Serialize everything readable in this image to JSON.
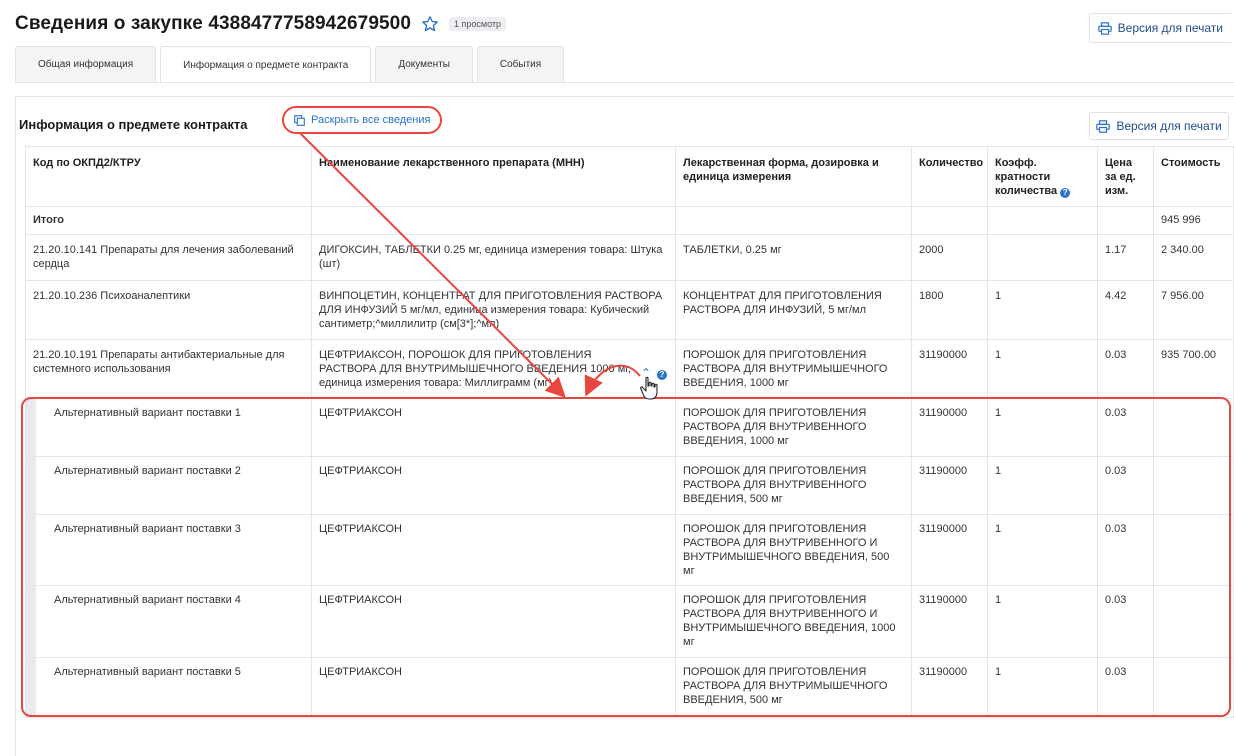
{
  "header": {
    "title": "Сведения о закупке 4388477758942679500",
    "views": "1 просмотр",
    "print_label": "Версия для печати"
  },
  "tabs": [
    {
      "label": "Общая информация",
      "active": false
    },
    {
      "label": "Информация о предмете контракта",
      "active": true
    },
    {
      "label": "Документы",
      "active": false
    },
    {
      "label": "События",
      "active": false
    }
  ],
  "section": {
    "title": "Информация о предмете контракта",
    "expand_label": "Раскрыть все сведения",
    "print_label": "Версия для печати"
  },
  "table": {
    "headers": {
      "code": "Код по ОКПД2/КТРУ",
      "name": "Наименование лекарственного препарата (МНН)",
      "form": "Лекарственная форма, дозировка и единица измерения",
      "qty": "Количество",
      "coef": "Коэфф. кратности количества",
      "price": "Цена за ед. изм.",
      "cost": "Стоимость"
    },
    "total": {
      "label": "Итого",
      "cost": "945 996"
    },
    "rows": [
      {
        "code": "21.20.10.141 Препараты для лечения заболеваний сердца",
        "name": "ДИГОКСИН, ТАБЛЕТКИ 0.25 мг, единица измерения товара: Штука (шт)",
        "form": "ТАБЛЕТКИ, 0.25 мг",
        "qty": "2000",
        "coef": "",
        "price": "1.17",
        "cost": "2 340.00"
      },
      {
        "code": "21.20.10.236 Психоаналептики",
        "name": "ВИНПОЦЕТИН, КОНЦЕНТРАТ ДЛЯ ПРИГОТОВЛЕНИЯ РАСТВОРА ДЛЯ ИНФУЗИЙ 5 мг/мл, единица измерения товара: Кубический сантиметр;^миллилитр (см[3*];^мл)",
        "form": "КОНЦЕНТРАТ ДЛЯ ПРИГОТОВЛЕНИЯ РАСТВОРА ДЛЯ ИНФУЗИЙ, 5 мг/мл",
        "qty": "1800",
        "coef": "1",
        "price": "4.42",
        "cost": "7 956.00"
      },
      {
        "code": "21.20.10.191 Препараты антибактериальные для системного использования",
        "name": "ЦЕФТРИАКСОН, ПОРОШОК ДЛЯ ПРИГОТОВЛЕНИЯ РАСТВОРА ДЛЯ ВНУТРИМЫШЕЧНОГО ВВЕДЕНИЯ 1000 мг, единица измерения товара: Миллиграмм (мг)",
        "form": "ПОРОШОК ДЛЯ ПРИГОТОВЛЕНИЯ РАСТВОРА ДЛЯ ВНУТРИМЫШЕЧНОГО ВВЕДЕНИЯ, 1000 мг",
        "qty": "31190000",
        "coef": "1",
        "price": "0.03",
        "cost": "935 700.00"
      }
    ],
    "alternatives": [
      {
        "label": "Альтернативный вариант поставки 1",
        "name": "ЦЕФТРИАКСОН",
        "form": "ПОРОШОК ДЛЯ ПРИГОТОВЛЕНИЯ РАСТВОРА ДЛЯ ВНУТРИВЕННОГО ВВЕДЕНИЯ, 1000 мг",
        "qty": "31190000",
        "coef": "1",
        "price": "0.03"
      },
      {
        "label": "Альтернативный вариант поставки 2",
        "name": "ЦЕФТРИАКСОН",
        "form": "ПОРОШОК ДЛЯ ПРИГОТОВЛЕНИЯ РАСТВОРА ДЛЯ ВНУТРИВЕННОГО ВВЕДЕНИЯ, 500 мг",
        "qty": "31190000",
        "coef": "1",
        "price": "0.03"
      },
      {
        "label": "Альтернативный вариант поставки 3",
        "name": "ЦЕФТРИАКСОН",
        "form": "ПОРОШОК ДЛЯ ПРИГОТОВЛЕНИЯ РАСТВОРА ДЛЯ ВНУТРИВЕННОГО И ВНУТРИМЫШЕЧНОГО ВВЕДЕНИЯ, 500 мг",
        "qty": "31190000",
        "coef": "1",
        "price": "0.03"
      },
      {
        "label": "Альтернативный вариант поставки 4",
        "name": "ЦЕФТРИАКСОН",
        "form": "ПОРОШОК ДЛЯ ПРИГОТОВЛЕНИЯ РАСТВОРА ДЛЯ ВНУТРИВЕННОГО И ВНУТРИМЫШЕЧНОГО ВВЕДЕНИЯ, 1000 мг",
        "qty": "31190000",
        "coef": "1",
        "price": "0.03"
      },
      {
        "label": "Альтернативный вариант поставки 5",
        "name": "ЦЕФТРИАКСОН",
        "form": "ПОРОШОК ДЛЯ ПРИГОТОВЛЕНИЯ РАСТВОРА ДЛЯ ВНУТРИМЫШЕЧНОГО ВВЕДЕНИЯ, 500 мг",
        "qty": "31190000",
        "coef": "1",
        "price": "0.03"
      }
    ]
  },
  "colors": {
    "accent": "#2a72c9",
    "annotation": "#e8473f"
  },
  "icons": [
    "star-icon",
    "printer-icon",
    "copy-icon",
    "help-icon",
    "chevron-up-icon",
    "hand-cursor-icon"
  ]
}
